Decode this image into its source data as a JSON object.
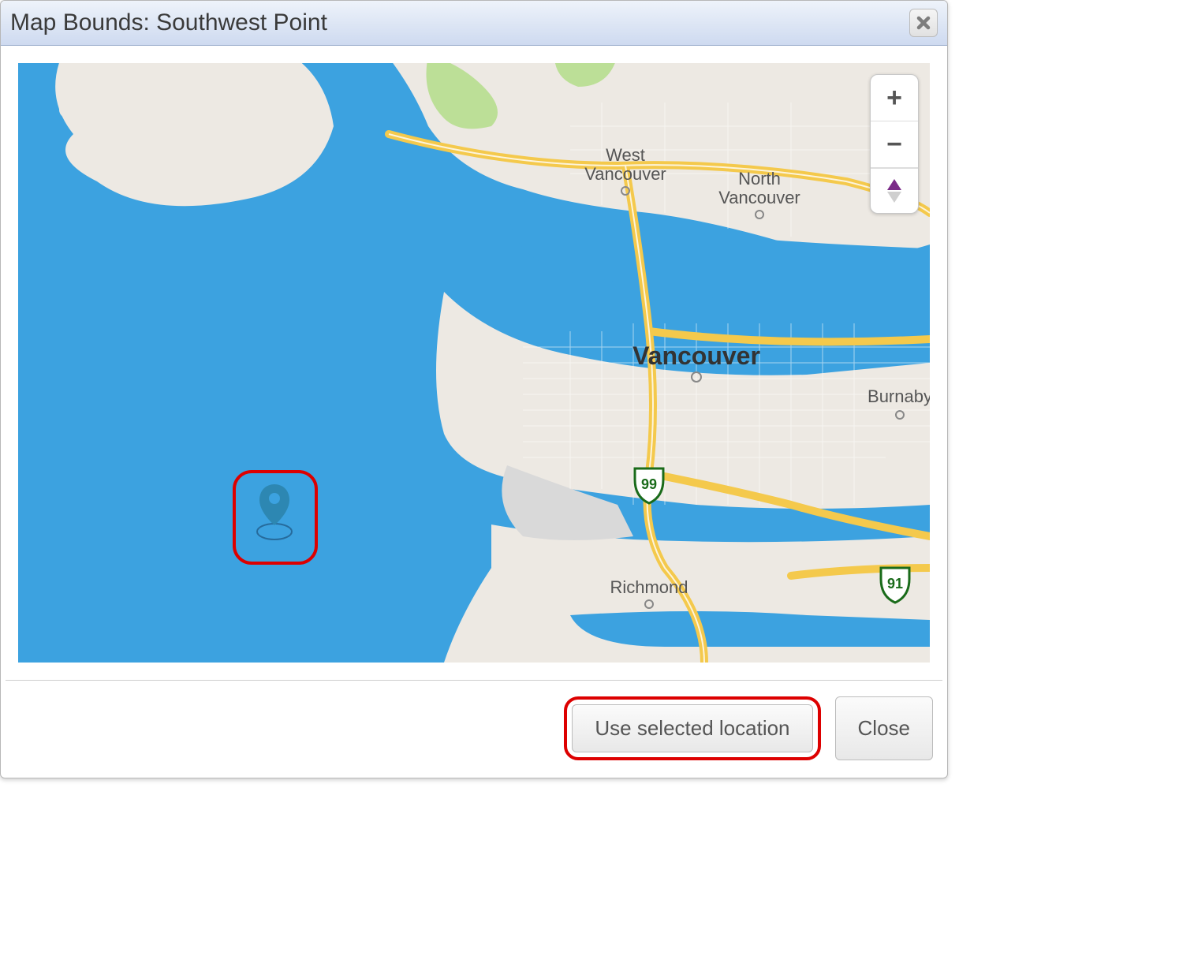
{
  "dialog": {
    "title": "Map Bounds: Southwest Point",
    "close_icon": "close-icon"
  },
  "map": {
    "labels": {
      "west_vancouver_line1": "West",
      "west_vancouver_line2": "Vancouver",
      "north_vancouver_line1": "North",
      "north_vancouver_line2": "Vancouver",
      "vancouver": "Vancouver",
      "burnaby": "Burnaby",
      "richmond": "Richmond"
    },
    "shields": {
      "hwy_99": "99",
      "hwy_91": "91"
    },
    "controls": {
      "zoom_in_label": "+",
      "zoom_out_label": "−"
    }
  },
  "footer": {
    "use_selected_label": "Use selected location",
    "close_label": "Close"
  }
}
